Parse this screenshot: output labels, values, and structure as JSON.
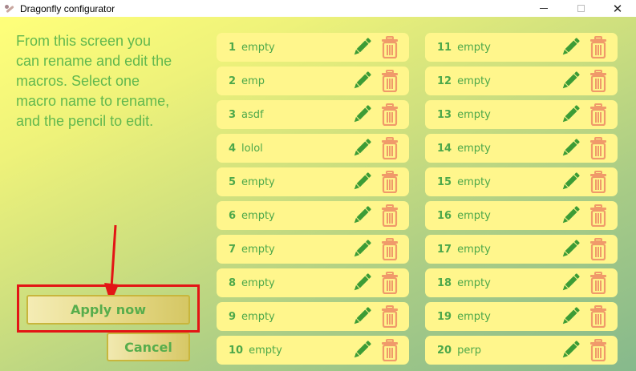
{
  "window": {
    "title": "Dragonfly configurator",
    "controls": {
      "minimize": "—",
      "maximize": "☐",
      "close": "✕"
    }
  },
  "instructions": "From this screen you can rename and edit the macros. Select one macro name to rename, and the pencil to edit.",
  "macros": [
    {
      "num": "1",
      "name": "empty"
    },
    {
      "num": "2",
      "name": "emp"
    },
    {
      "num": "3",
      "name": "asdf"
    },
    {
      "num": "4",
      "name": "lolol"
    },
    {
      "num": "5",
      "name": "empty"
    },
    {
      "num": "6",
      "name": "empty"
    },
    {
      "num": "7",
      "name": "empty"
    },
    {
      "num": "8",
      "name": "empty"
    },
    {
      "num": "9",
      "name": "empty"
    },
    {
      "num": "10",
      "name": "empty"
    },
    {
      "num": "11",
      "name": "empty"
    },
    {
      "num": "12",
      "name": "empty"
    },
    {
      "num": "13",
      "name": "empty"
    },
    {
      "num": "14",
      "name": "empty"
    },
    {
      "num": "15",
      "name": "empty"
    },
    {
      "num": "16",
      "name": "empty"
    },
    {
      "num": "17",
      "name": "empty"
    },
    {
      "num": "18",
      "name": "empty"
    },
    {
      "num": "19",
      "name": "empty"
    },
    {
      "num": "20",
      "name": "perp"
    }
  ],
  "buttons": {
    "apply": "Apply now",
    "cancel": "Cancel"
  },
  "icons": {
    "edit": "pencil-icon",
    "delete": "trash-icon"
  },
  "colors": {
    "accent_green": "#4da84a",
    "pencil_green": "#3c9c36",
    "trash_salmon": "#f09a6a",
    "row_yellow": "#fff68c",
    "highlight_red": "#e31515"
  }
}
